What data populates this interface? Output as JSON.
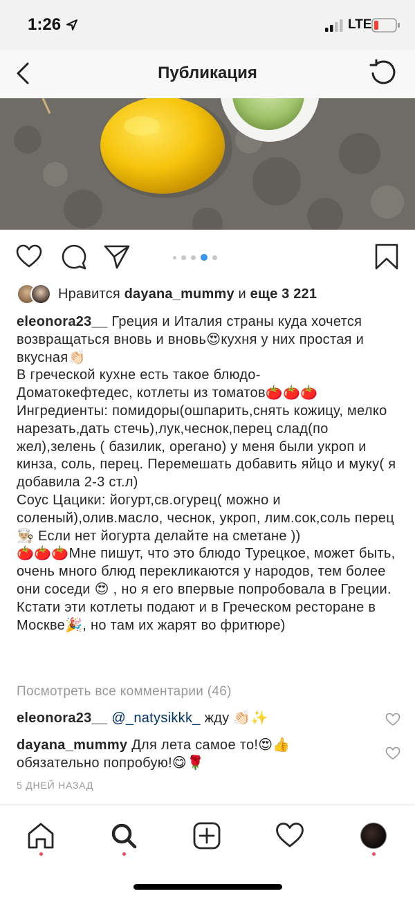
{
  "status_bar": {
    "time": "1:26",
    "network": "LTE",
    "icons": [
      "location-arrow-icon",
      "signal-icon",
      "battery-icon"
    ]
  },
  "nav": {
    "title": "Публикация",
    "icons": [
      "chevron-left-icon",
      "refresh-icon"
    ]
  },
  "actions": {
    "icons": [
      "heart-icon",
      "comment-icon",
      "share-icon",
      "bookmark-icon"
    ],
    "carousel_active_index": 2
  },
  "likes": {
    "prefix": "Нравится",
    "user": "dayana_mummy",
    "conj": "и",
    "count_text": "еще 3 221"
  },
  "caption": {
    "user": "eleonora23__",
    "paragraphs": [
      "Греция и Италия страны куда хочется возвращаться вновь и вновь😍кухня у них простая и вкусная👏🏻",
      "В греческой кухне есть такое блюдо-\nДоматокефтедес, котлеты из томатов🍅🍅🍅",
      "Ингредиенты: помидоры(ошпарить,снять кожицу, мелко нарезать,дать стечь),лук,чеснок,перец слад(по жел),зелень ( базилик, орегано) у меня были укроп и кинза, соль, перец. Перемешать добавить яйцо и муку( я добавила 2-3 ст.л)",
      "Соус Цацики: йогурт,св.огурец( можно и соленый),олив.масло, чеснок, укроп, лим.сок,соль перец 👨🏼‍🍳 Если нет йогурта делайте на сметане ))",
      "🍅🍅🍅Мне пишут, что это блюдо Турецкое, может быть, очень много блюд перекликаются у народов, тем более они соседи 😍 , но я его впервые попробовала в Греции. Кстати эти котлеты подают и в Греческом ресторане в Москве🎉, но там их жарят во фритюре)"
    ]
  },
  "view_all_comments": "Посмотреть все комментарии (46)",
  "comments": [
    {
      "user": "eleonora23__",
      "mention": "@_natysikkk_",
      "text": " жду 👏🏻✨"
    },
    {
      "user": "dayana_mummy",
      "mention": "",
      "text": " Для лета самое то!😍👍\nобязательно попробую!😋🌹"
    }
  ],
  "timestamp": "5 ДНЕЙ НАЗАД",
  "tabbar": {
    "icons": [
      "home-icon",
      "search-icon",
      "add-post-icon",
      "activity-heart-icon",
      "profile-avatar"
    ]
  },
  "colors": {
    "text": "#262626",
    "muted": "#999999",
    "accent_blue": "#3897f0",
    "mention": "#003569",
    "notification_red": "#ed4956"
  }
}
